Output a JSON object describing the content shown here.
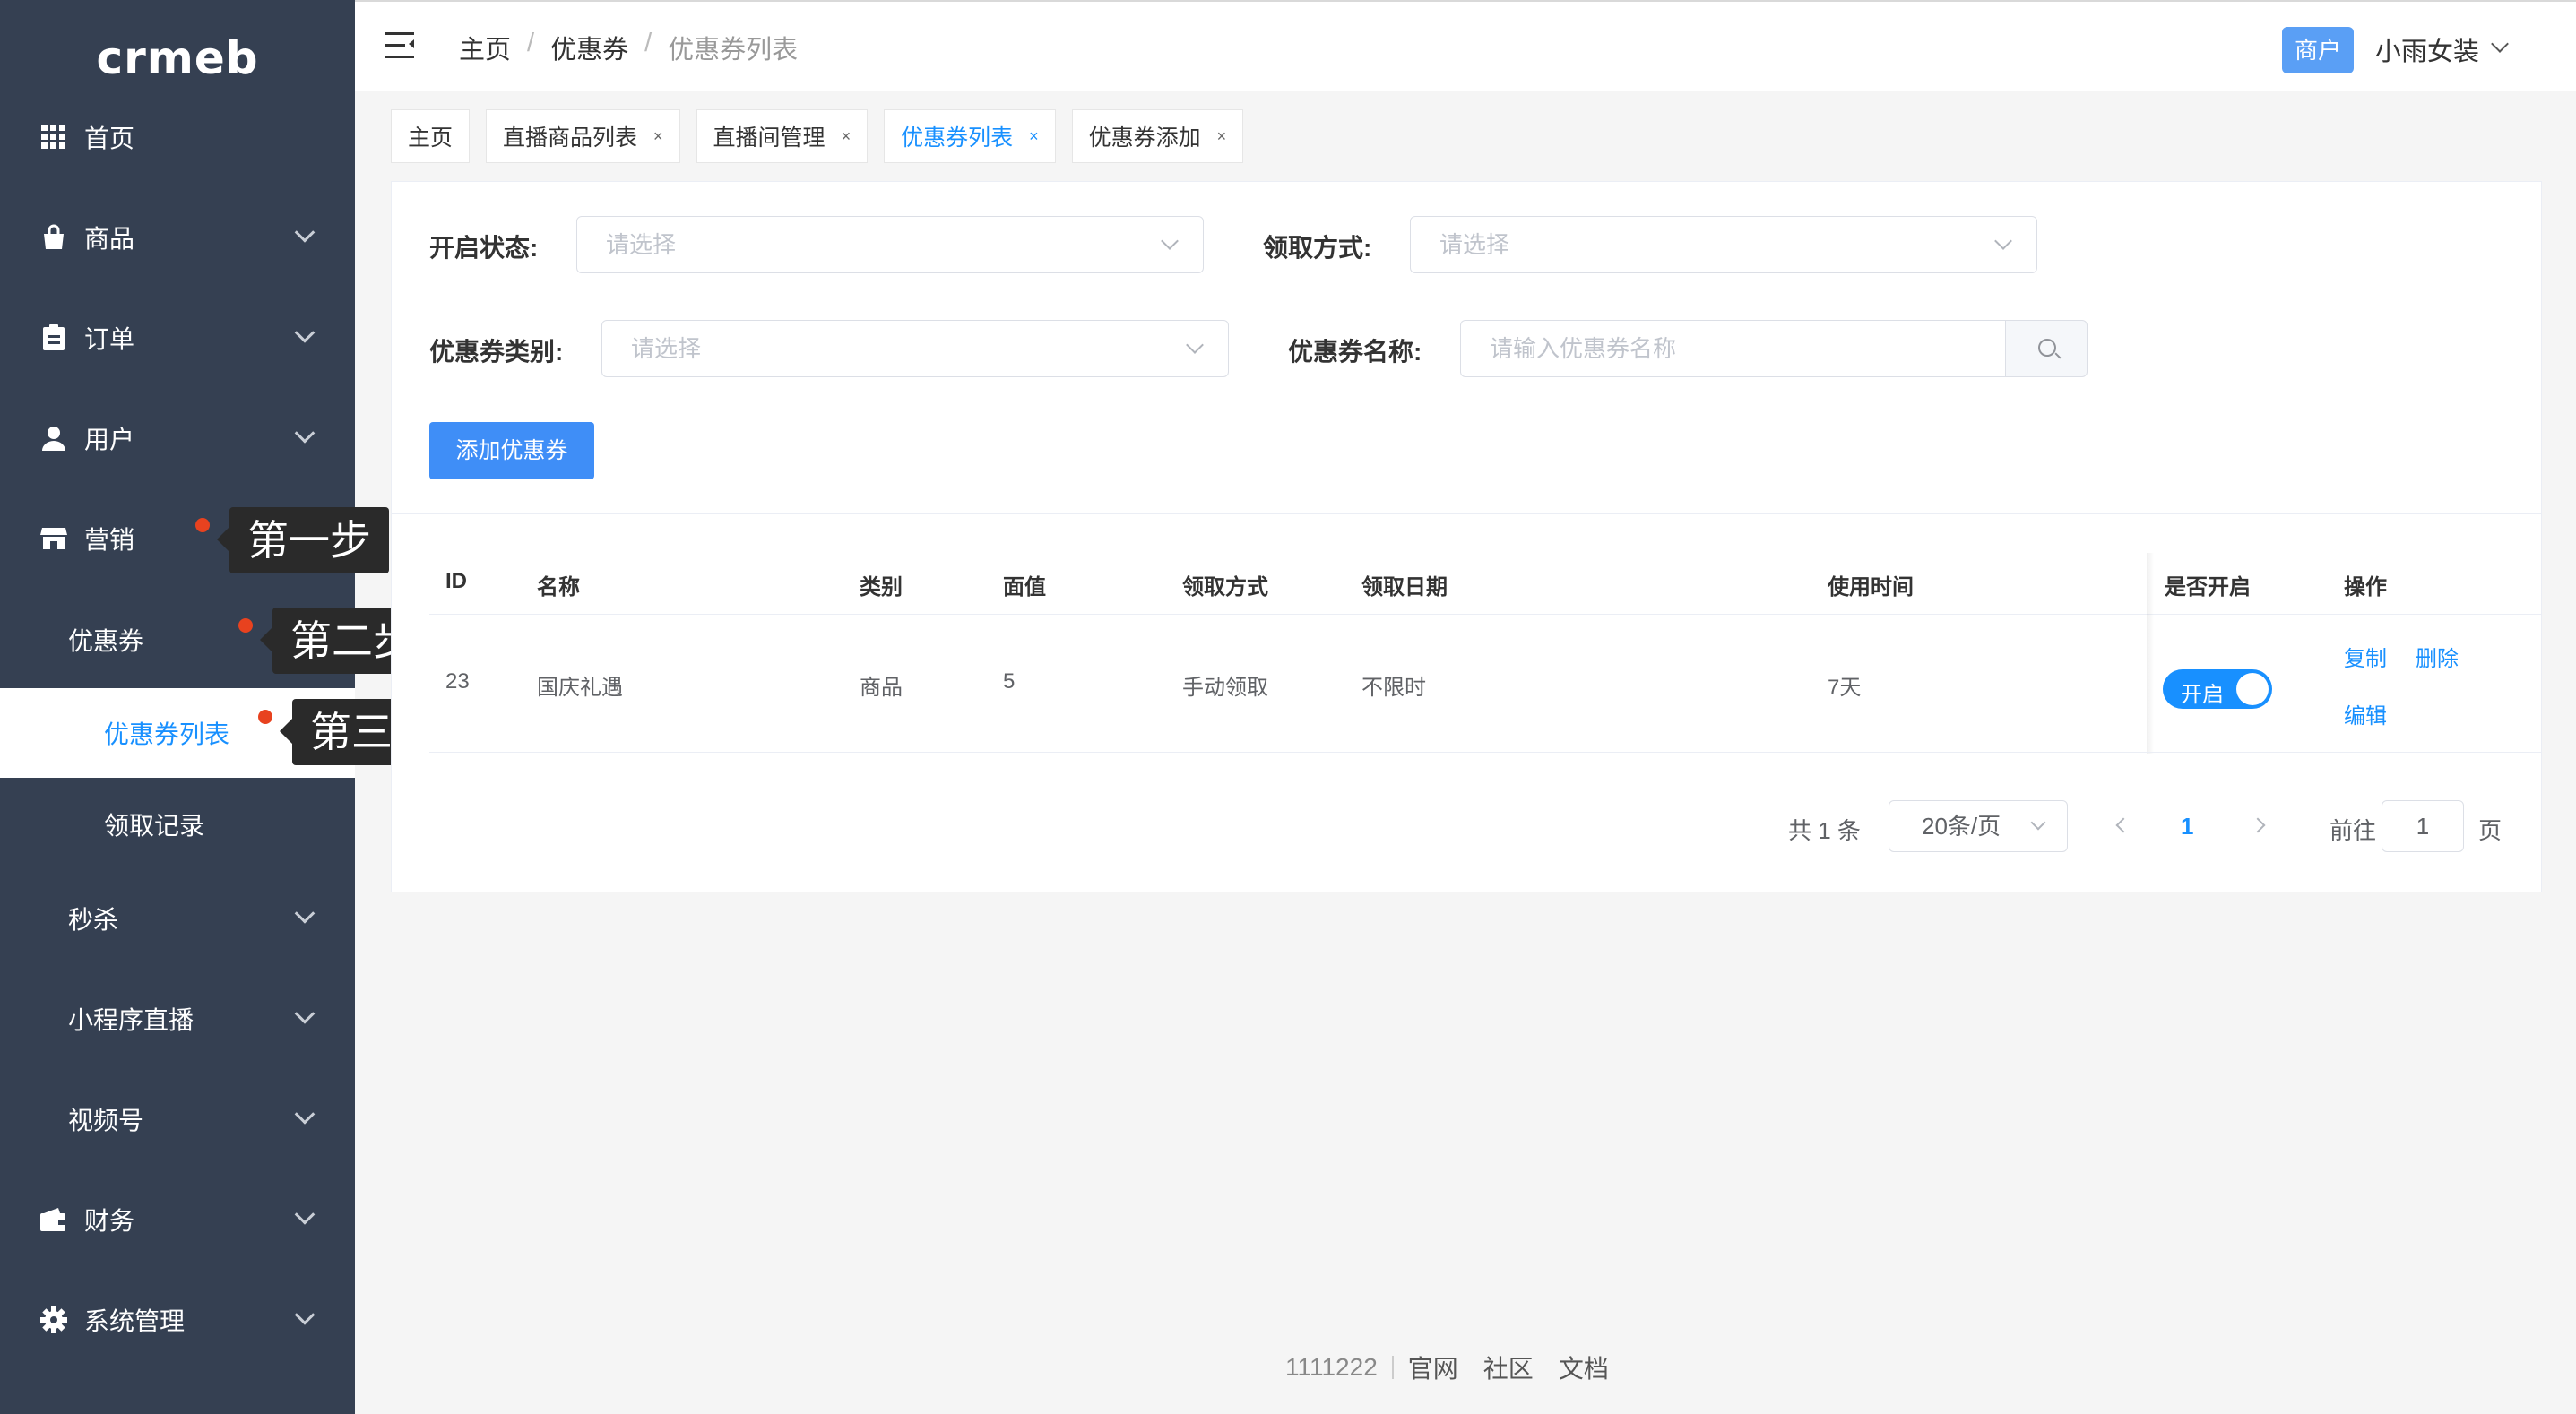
{
  "sidebar": {
    "logo": "crmeb",
    "menu": [
      {
        "label": "首页",
        "icon": "grid-icon"
      },
      {
        "label": "商品",
        "icon": "bag-icon"
      },
      {
        "label": "订单",
        "icon": "clipboard-icon"
      },
      {
        "label": "用户",
        "icon": "user-icon"
      },
      {
        "label": "营销",
        "icon": "store-icon"
      }
    ],
    "marketing_sub": {
      "coupon": "优惠券",
      "coupon_list": "优惠券列表",
      "receive_records": "领取记录",
      "seckill": "秒杀",
      "mini_live": "小程序直播",
      "video_channel": "视频号"
    },
    "bottom_menu": [
      {
        "label": "财务",
        "icon": "wallet-icon"
      },
      {
        "label": "系统管理",
        "icon": "gear-icon"
      }
    ]
  },
  "steps": {
    "step1": "第一步",
    "step2": "第二步",
    "step3": "第三步"
  },
  "header": {
    "breadcrumb": [
      "主页",
      "优惠券",
      "优惠券列表"
    ],
    "role_badge": "商户",
    "user_name": "小雨女装"
  },
  "tags": [
    {
      "label": "主页",
      "closable": false,
      "active": false
    },
    {
      "label": "直播商品列表",
      "closable": true,
      "active": false
    },
    {
      "label": "直播间管理",
      "closable": true,
      "active": false
    },
    {
      "label": "优惠券列表",
      "closable": true,
      "active": true
    },
    {
      "label": "优惠券添加",
      "closable": true,
      "active": false
    }
  ],
  "tag_close_glyph": "×",
  "filters": {
    "status_label": "开启状态:",
    "status_placeholder": "请选择",
    "method_label": "领取方式:",
    "method_placeholder": "请选择",
    "type_label": "优惠券类别:",
    "type_placeholder": "请选择",
    "name_label": "优惠券名称:",
    "name_placeholder": "请输入优惠券名称"
  },
  "add_button": "添加优惠券",
  "table": {
    "columns": {
      "id": "ID",
      "name": "名称",
      "type": "类别",
      "value": "面值",
      "method": "领取方式",
      "date": "领取日期",
      "use_time": "使用时间",
      "enabled": "是否开启",
      "ops": "操作"
    },
    "rows": [
      {
        "id": "23",
        "name": "国庆礼遇",
        "type": "商品",
        "value": "5",
        "method": "手动领取",
        "date": "不限时",
        "use_time": "7天",
        "switch_text": "开启",
        "ops": {
          "copy": "复制",
          "delete": "删除",
          "edit": "编辑"
        }
      }
    ]
  },
  "pagination": {
    "total": "共 1 条",
    "page_size": "20条/页",
    "current": "1",
    "goto_label": "前往",
    "goto_value": "1",
    "page_suffix": "页"
  },
  "footer": {
    "copyright": "1111222",
    "links": [
      "官网",
      "社区",
      "文档"
    ]
  },
  "colors": {
    "sidebar_bg": "#354052",
    "primary": "#1890ff",
    "button_blue": "#3f8ef7",
    "step_dot": "#e8421f"
  }
}
